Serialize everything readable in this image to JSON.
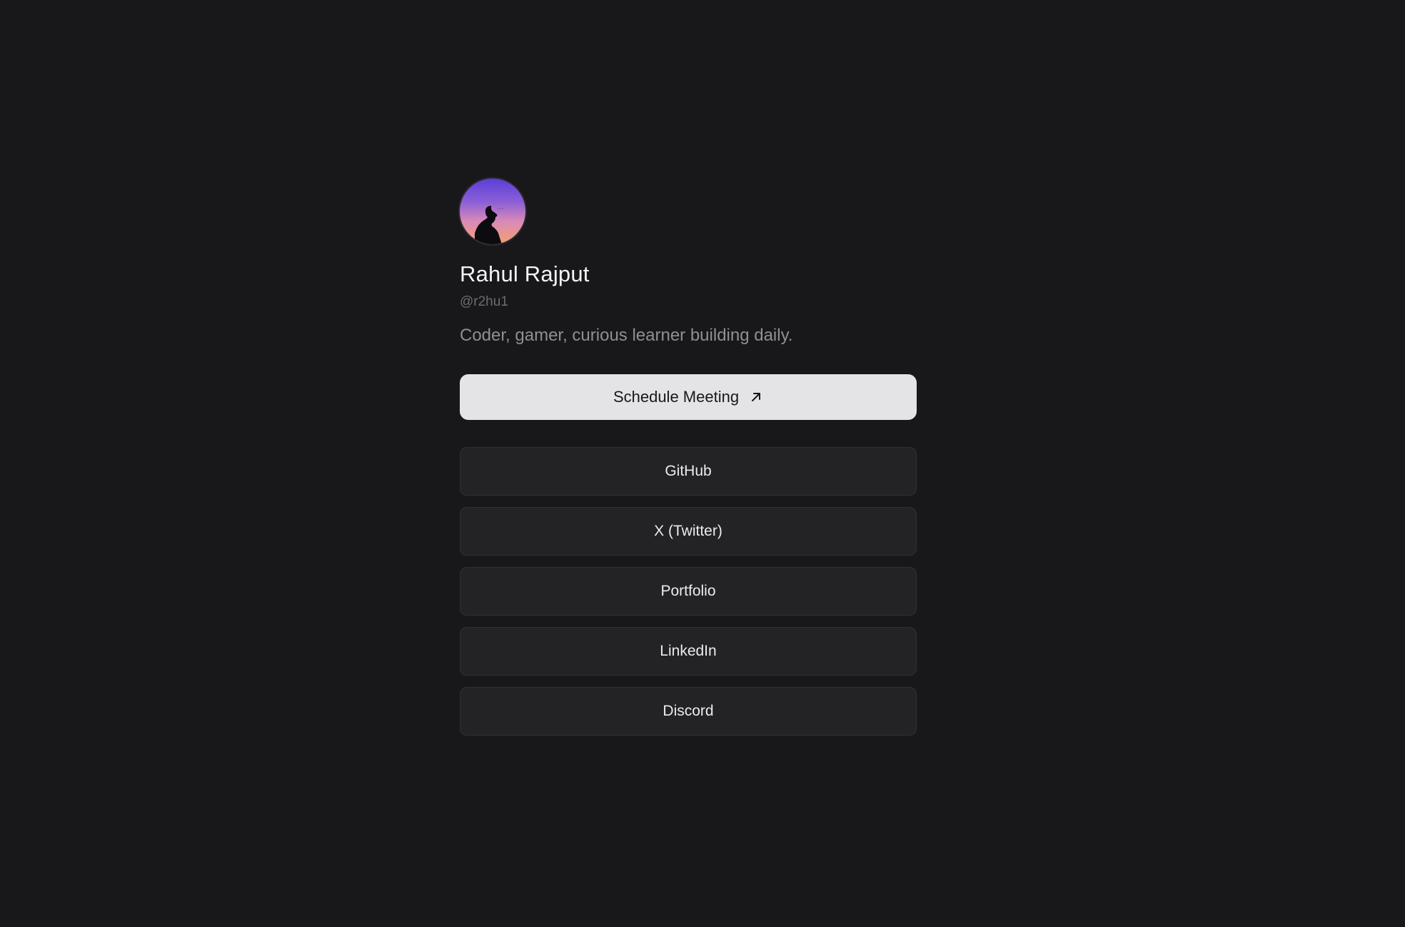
{
  "profile": {
    "avatar_icon": "profile-photo-silhouette-sunset",
    "name": "Rahul Rajput",
    "handle": "@r2hu1",
    "bio": "Coder, gamer, curious learner building daily."
  },
  "cta": {
    "label": "Schedule Meeting",
    "icon": "arrow-up-right-icon"
  },
  "links": [
    {
      "label": "GitHub"
    },
    {
      "label": "X (Twitter)"
    },
    {
      "label": "Portfolio"
    },
    {
      "label": "LinkedIn"
    },
    {
      "label": "Discord"
    }
  ],
  "colors": {
    "background": "#18181b",
    "cta_background": "#e4e4e7",
    "link_background": "#232326",
    "link_border": "#303036"
  }
}
